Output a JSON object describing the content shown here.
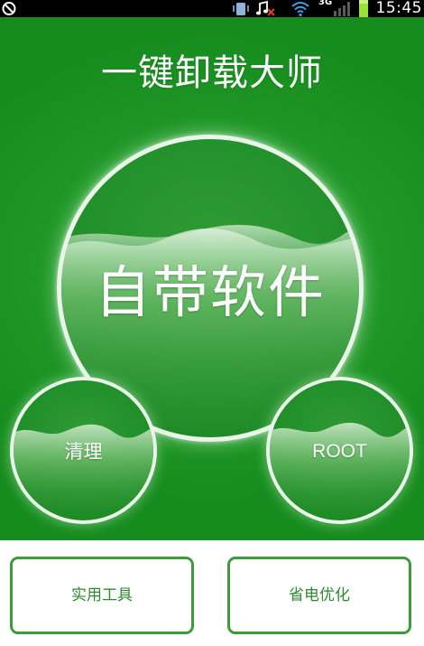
{
  "status_bar": {
    "time": "15:45",
    "network_label": "3G",
    "icons": [
      "do-not-disturb-icon",
      "vibrate-icon",
      "music-muted-icon",
      "wifi-icon",
      "signal-icon",
      "battery-icon"
    ]
  },
  "app": {
    "title": "一键卸载大师"
  },
  "bubbles": {
    "main_label": "自带软件",
    "left_label": "清理",
    "right_label": "ROOT"
  },
  "buttons": {
    "tools_label": "实用工具",
    "power_label": "省电优化"
  },
  "colors": {
    "primary_green": "#1f8f26",
    "button_border": "#3d9a3d",
    "button_text": "#2f8a2f",
    "status_bar": "#000000"
  }
}
